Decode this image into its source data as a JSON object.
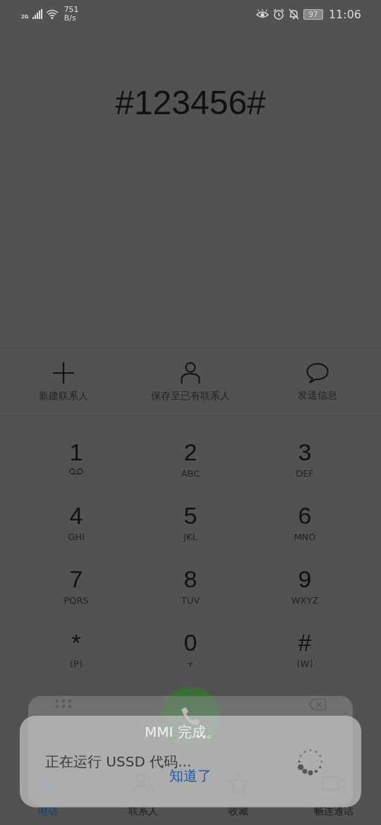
{
  "status_bar": {
    "network": "2G",
    "speed_value": "751",
    "speed_unit": "B/s",
    "battery": "97",
    "time": "11:06"
  },
  "dialed_number": "#123456#",
  "actions": [
    {
      "kind": "add",
      "label": "新建联系人"
    },
    {
      "kind": "person",
      "label": "保存至已有联系人"
    },
    {
      "kind": "message",
      "label": "发送信息"
    }
  ],
  "keypad": [
    {
      "kind": "voicemail",
      "digit": "1"
    },
    {
      "kind": "text",
      "digit": "2",
      "sub": "ABC"
    },
    {
      "kind": "text",
      "digit": "3",
      "sub": "DEF"
    },
    {
      "kind": "text",
      "digit": "4",
      "sub": "GHI"
    },
    {
      "kind": "text",
      "digit": "5",
      "sub": "JKL"
    },
    {
      "kind": "text",
      "digit": "6",
      "sub": "MNO"
    },
    {
      "kind": "text",
      "digit": "7",
      "sub": "PQRS"
    },
    {
      "kind": "text",
      "digit": "8",
      "sub": "TUV"
    },
    {
      "kind": "text",
      "digit": "9",
      "sub": "WXYZ"
    },
    {
      "kind": "text",
      "digit": "*",
      "sub": "(P)"
    },
    {
      "kind": "text",
      "digit": "0",
      "sub": "+"
    },
    {
      "kind": "text",
      "digit": "#",
      "sub": "(W)"
    }
  ],
  "tabs": [
    {
      "kind": "phone",
      "label": "电话",
      "selected": true
    },
    {
      "kind": "contacts",
      "label": "联系人",
      "selected": false
    },
    {
      "kind": "star",
      "label": "收藏",
      "selected": false
    },
    {
      "kind": "video",
      "label": "畅连通话",
      "selected": false
    }
  ],
  "mmi_dialog": {
    "message": "MMI 完成。",
    "button": "知道了"
  },
  "ussd_dialog": {
    "message": "正在运行 USSD 代码..."
  }
}
